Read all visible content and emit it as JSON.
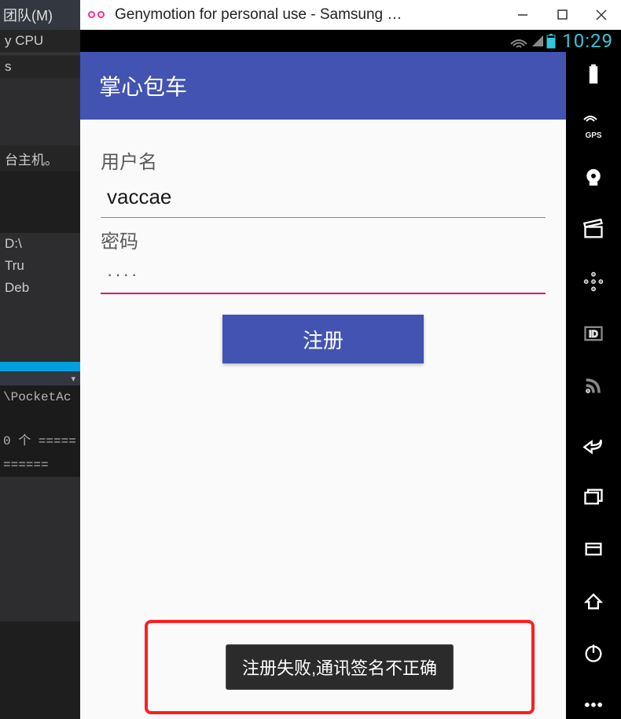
{
  "ide": {
    "menu_team": "团队(M)",
    "cpu": "y CPU",
    "s": "s",
    "host_note": "台主机。",
    "path_d": "D:\\",
    "true": "Tru",
    "deb": "Deb",
    "pocket": "\\PocketAc",
    "count": "0 个 =====",
    "equals": "======"
  },
  "titlebar": {
    "text": "Genymotion for personal use - Samsung …"
  },
  "statusbar": {
    "clock": "10:29"
  },
  "appbar": {
    "title": "掌心包车"
  },
  "form": {
    "username_label": "用户名",
    "username_value": "vaccae",
    "password_label": "密码",
    "password_value": "····",
    "register_label": "注册"
  },
  "toast": {
    "message": "注册失败,通讯签名不正确"
  },
  "colors": {
    "primary": "#4353b1",
    "accent": "#dd0f6f",
    "status": "#37c5dd"
  }
}
